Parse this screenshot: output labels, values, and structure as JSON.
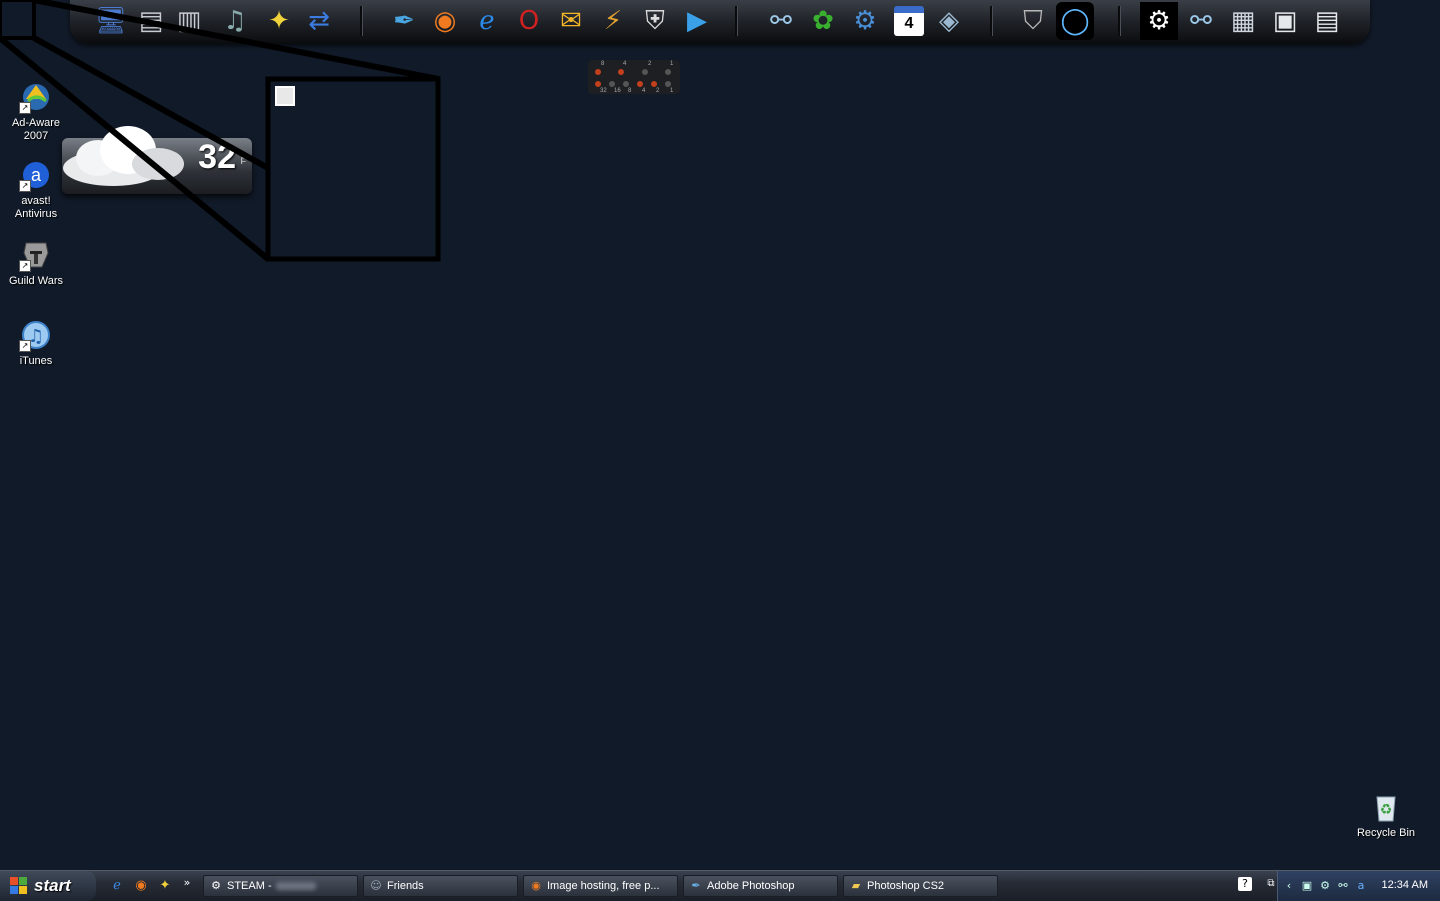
{
  "desktop": {
    "icons": [
      {
        "label": "Ad-Aware 2007"
      },
      {
        "label": "avast! Antivirus"
      },
      {
        "label": "Guild Wars"
      },
      {
        "label": "iTunes"
      }
    ],
    "recycle_bin": {
      "label": "Recycle Bin"
    }
  },
  "weather": {
    "temperature": "32",
    "unit": "F"
  },
  "binary_clock": {
    "top_labels": [
      "8",
      "4",
      "2",
      "1"
    ],
    "bottom_labels": [
      "32",
      "16",
      "8",
      "4",
      "2",
      "1"
    ]
  },
  "dock": {
    "icons": [
      "my-computer-icon",
      "documents-icon",
      "folders-icon",
      "music-icon",
      "network-icon",
      "remote-desktop-icon",
      "feather-app-icon",
      "firefox-icon",
      "internet-explorer-icon",
      "opera-icon",
      "mail-icon",
      "thunderbird-icon",
      "clan-shield-icon",
      "media-player-icon",
      "connector-icon",
      "gecko-icon",
      "system-tools-icon",
      "calendar-icon",
      "cube-icon",
      "guild-wars-icon",
      "portal-icon",
      "steam-icon",
      "connector-icon-2",
      "control-panel-icon",
      "window-manager-icon"
    ],
    "calendar_day": "4"
  },
  "taskbar": {
    "start_label": "start",
    "quick_launch_more": "»",
    "buttons": [
      {
        "label": "STEAM -",
        "icon": "steam-icon"
      },
      {
        "label": "Friends",
        "icon": "friends-icon"
      },
      {
        "label": "Image hosting, free p...",
        "icon": "firefox-icon"
      },
      {
        "label": "Adobe Photoshop",
        "icon": "photoshop-icon"
      },
      {
        "label": "Photoshop CS2",
        "icon": "folder-icon"
      }
    ],
    "clock": "12:34 AM"
  },
  "colors": {
    "desktop_bg": "#111a28",
    "taskbar": "#262b35",
    "tray": "#2f4262"
  }
}
